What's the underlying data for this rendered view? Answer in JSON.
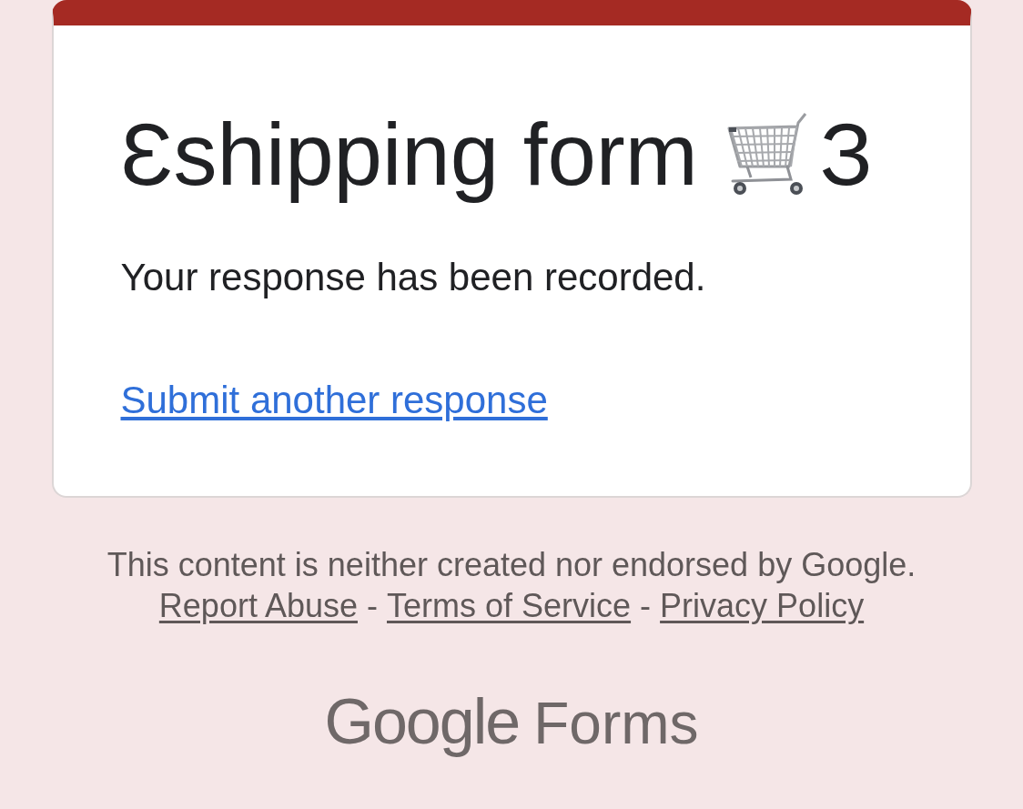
{
  "card": {
    "title": {
      "text_before": "Ɛshipping form",
      "text_after": "З"
    },
    "message": "Your response has been recorded.",
    "link": "Submit another response"
  },
  "footer": {
    "disclaimer": "This content is neither created nor endorsed by Google.",
    "links": [
      {
        "kind": "link",
        "text": "Report Abuse"
      },
      {
        "kind": "separator",
        "text": "-"
      },
      {
        "kind": "link",
        "text": "Terms of Service"
      },
      {
        "kind": "separator",
        "text": "-"
      },
      {
        "kind": "link",
        "text": "Privacy Policy"
      }
    ]
  },
  "logo": {
    "brand": "Google",
    "product": "Forms"
  }
}
